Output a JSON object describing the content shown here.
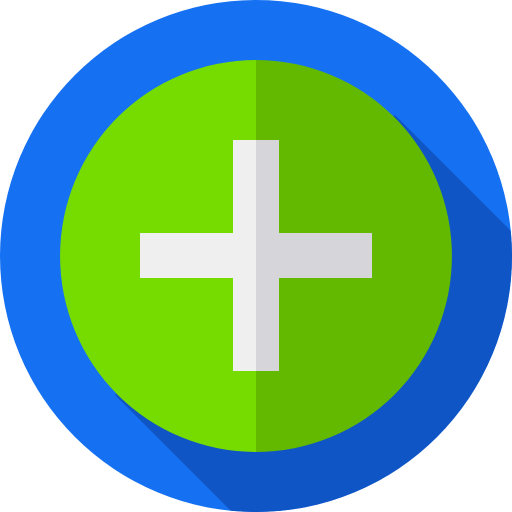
{
  "icon": {
    "name": "add-plus-icon",
    "colors": {
      "outer_circle": "#1571f2",
      "long_shadow": "#0f55c5",
      "inner_circle_left": "#76dc00",
      "inner_circle_right": "#62b900",
      "plus_left": "#efeff0",
      "plus_right": "#d6d6da"
    }
  }
}
